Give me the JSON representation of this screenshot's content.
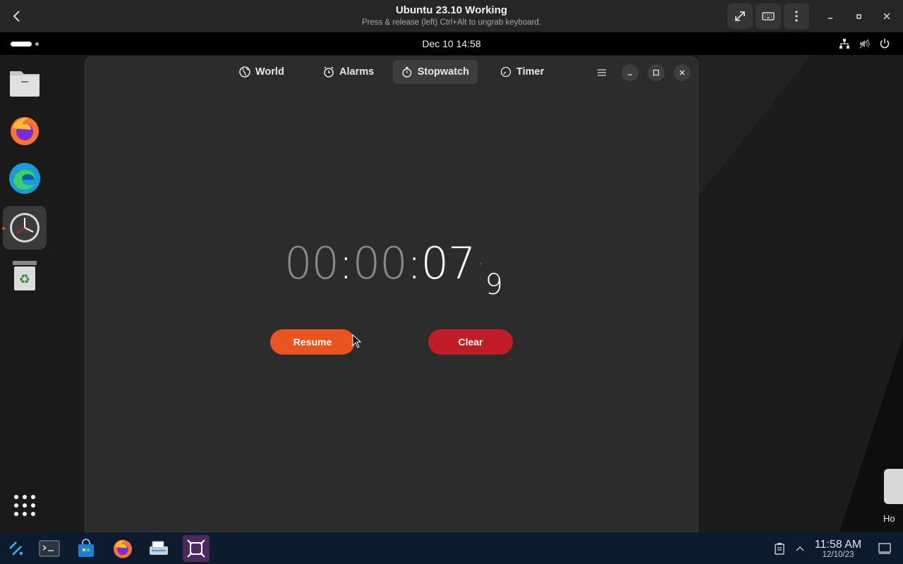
{
  "viewer": {
    "title": "Ubuntu 23.10 Working",
    "subtitle": "Press & release (left) Ctrl+Alt to ungrab keyboard."
  },
  "topbar": {
    "clock": "Dec 10  14:58"
  },
  "app": {
    "tabs": [
      {
        "label": "World",
        "icon": "globe-icon"
      },
      {
        "label": "Alarms",
        "icon": "alarm-icon"
      },
      {
        "label": "Stopwatch",
        "icon": "stopwatch-icon",
        "active": true
      },
      {
        "label": "Timer",
        "icon": "timer-icon"
      }
    ],
    "stopwatch": {
      "hours": "00",
      "minutes": "00",
      "seconds": "07",
      "tenths": "9",
      "resume_label": "Resume",
      "clear_label": "Clear"
    }
  },
  "desktop": {
    "icon_label": "Ho"
  },
  "taskbar": {
    "time": "11:58 AM",
    "date": "12/10/23"
  },
  "colors": {
    "accent": "#e95420",
    "destructive": "#c01c28",
    "window_bg": "#2c2c2c"
  }
}
